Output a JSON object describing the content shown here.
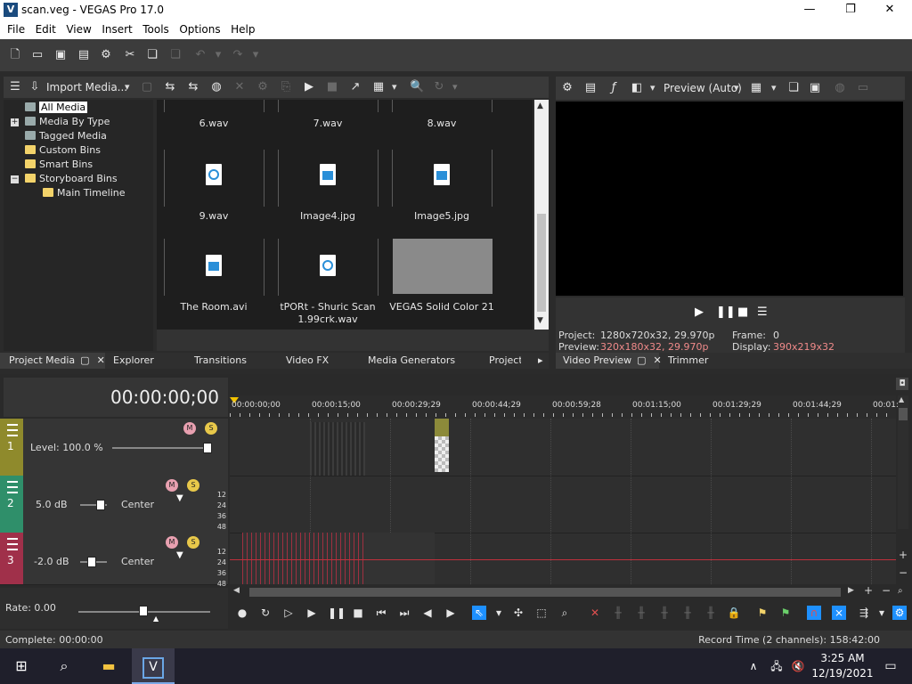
{
  "window": {
    "title": "scan.veg - VEGAS Pro 17.0",
    "app_icon": "V"
  },
  "menu": [
    "File",
    "Edit",
    "View",
    "Insert",
    "Tools",
    "Options",
    "Help"
  ],
  "project_media": {
    "import_label": "Import Media...",
    "tree": [
      {
        "label": "All Media",
        "selected": true
      },
      {
        "label": "Media By Type"
      },
      {
        "label": "Tagged Media"
      },
      {
        "label": "Custom Bins"
      },
      {
        "label": "Smart Bins"
      },
      {
        "label": "Storyboard Bins"
      },
      {
        "label": "Main Timeline"
      }
    ],
    "tiles": [
      {
        "label": "6.wav"
      },
      {
        "label": "7.wav"
      },
      {
        "label": "8.wav"
      },
      {
        "label": "9.wav"
      },
      {
        "label": "Image4.jpg"
      },
      {
        "label": "Image5.jpg"
      },
      {
        "label": "The Room.avi"
      },
      {
        "label": "tPORt - Shuric Scan 1.99crk.wav"
      },
      {
        "label": "VEGAS Solid Color 21"
      }
    ]
  },
  "left_tabs": [
    "Project Media",
    "Explorer",
    "Transitions",
    "Video FX",
    "Media Generators",
    "Project"
  ],
  "preview": {
    "mode": "Preview (Auto)",
    "project_label": "Project:",
    "project_value": "1280x720x32, 29.970p",
    "preview_label": "Preview:",
    "preview_value": "320x180x32, 29.970p",
    "frame_label": "Frame:",
    "frame_value": "0",
    "display_label": "Display:",
    "display_value": "390x219x32"
  },
  "right_tabs": [
    "Video Preview",
    "Trimmer"
  ],
  "timeline": {
    "timecode": "00:00:00;00",
    "ruler": [
      "00:00:00;00",
      "00:00:15;00",
      "00:00:29;29",
      "00:00:44;29",
      "00:00:59;28",
      "00:01:15;00",
      "00:01:29;29",
      "00:01:44;29",
      "00:01:"
    ],
    "tracks": [
      {
        "num": "1",
        "level": "Level: 100.0 %",
        "color": "#8f8a2c"
      },
      {
        "num": "2",
        "volume": "5.0 dB",
        "pan": "Center",
        "color": "#2f8f6a",
        "meters": [
          "12",
          "24",
          "36",
          "48"
        ]
      },
      {
        "num": "3",
        "volume": "-2.0 dB",
        "pan": "Center",
        "color": "#a0304a",
        "meters": [
          "12",
          "24",
          "36",
          "48"
        ]
      }
    ],
    "rate": "Rate: 0.00"
  },
  "status": {
    "left": "Complete: 00:00:00",
    "right": "Record Time (2 channels): 158:42:00"
  },
  "taskbar": {
    "time": "3:25 AM",
    "date": "12/19/2021"
  },
  "colors": {
    "accent": "#1e90ff",
    "red_text": "#f08a8a"
  }
}
